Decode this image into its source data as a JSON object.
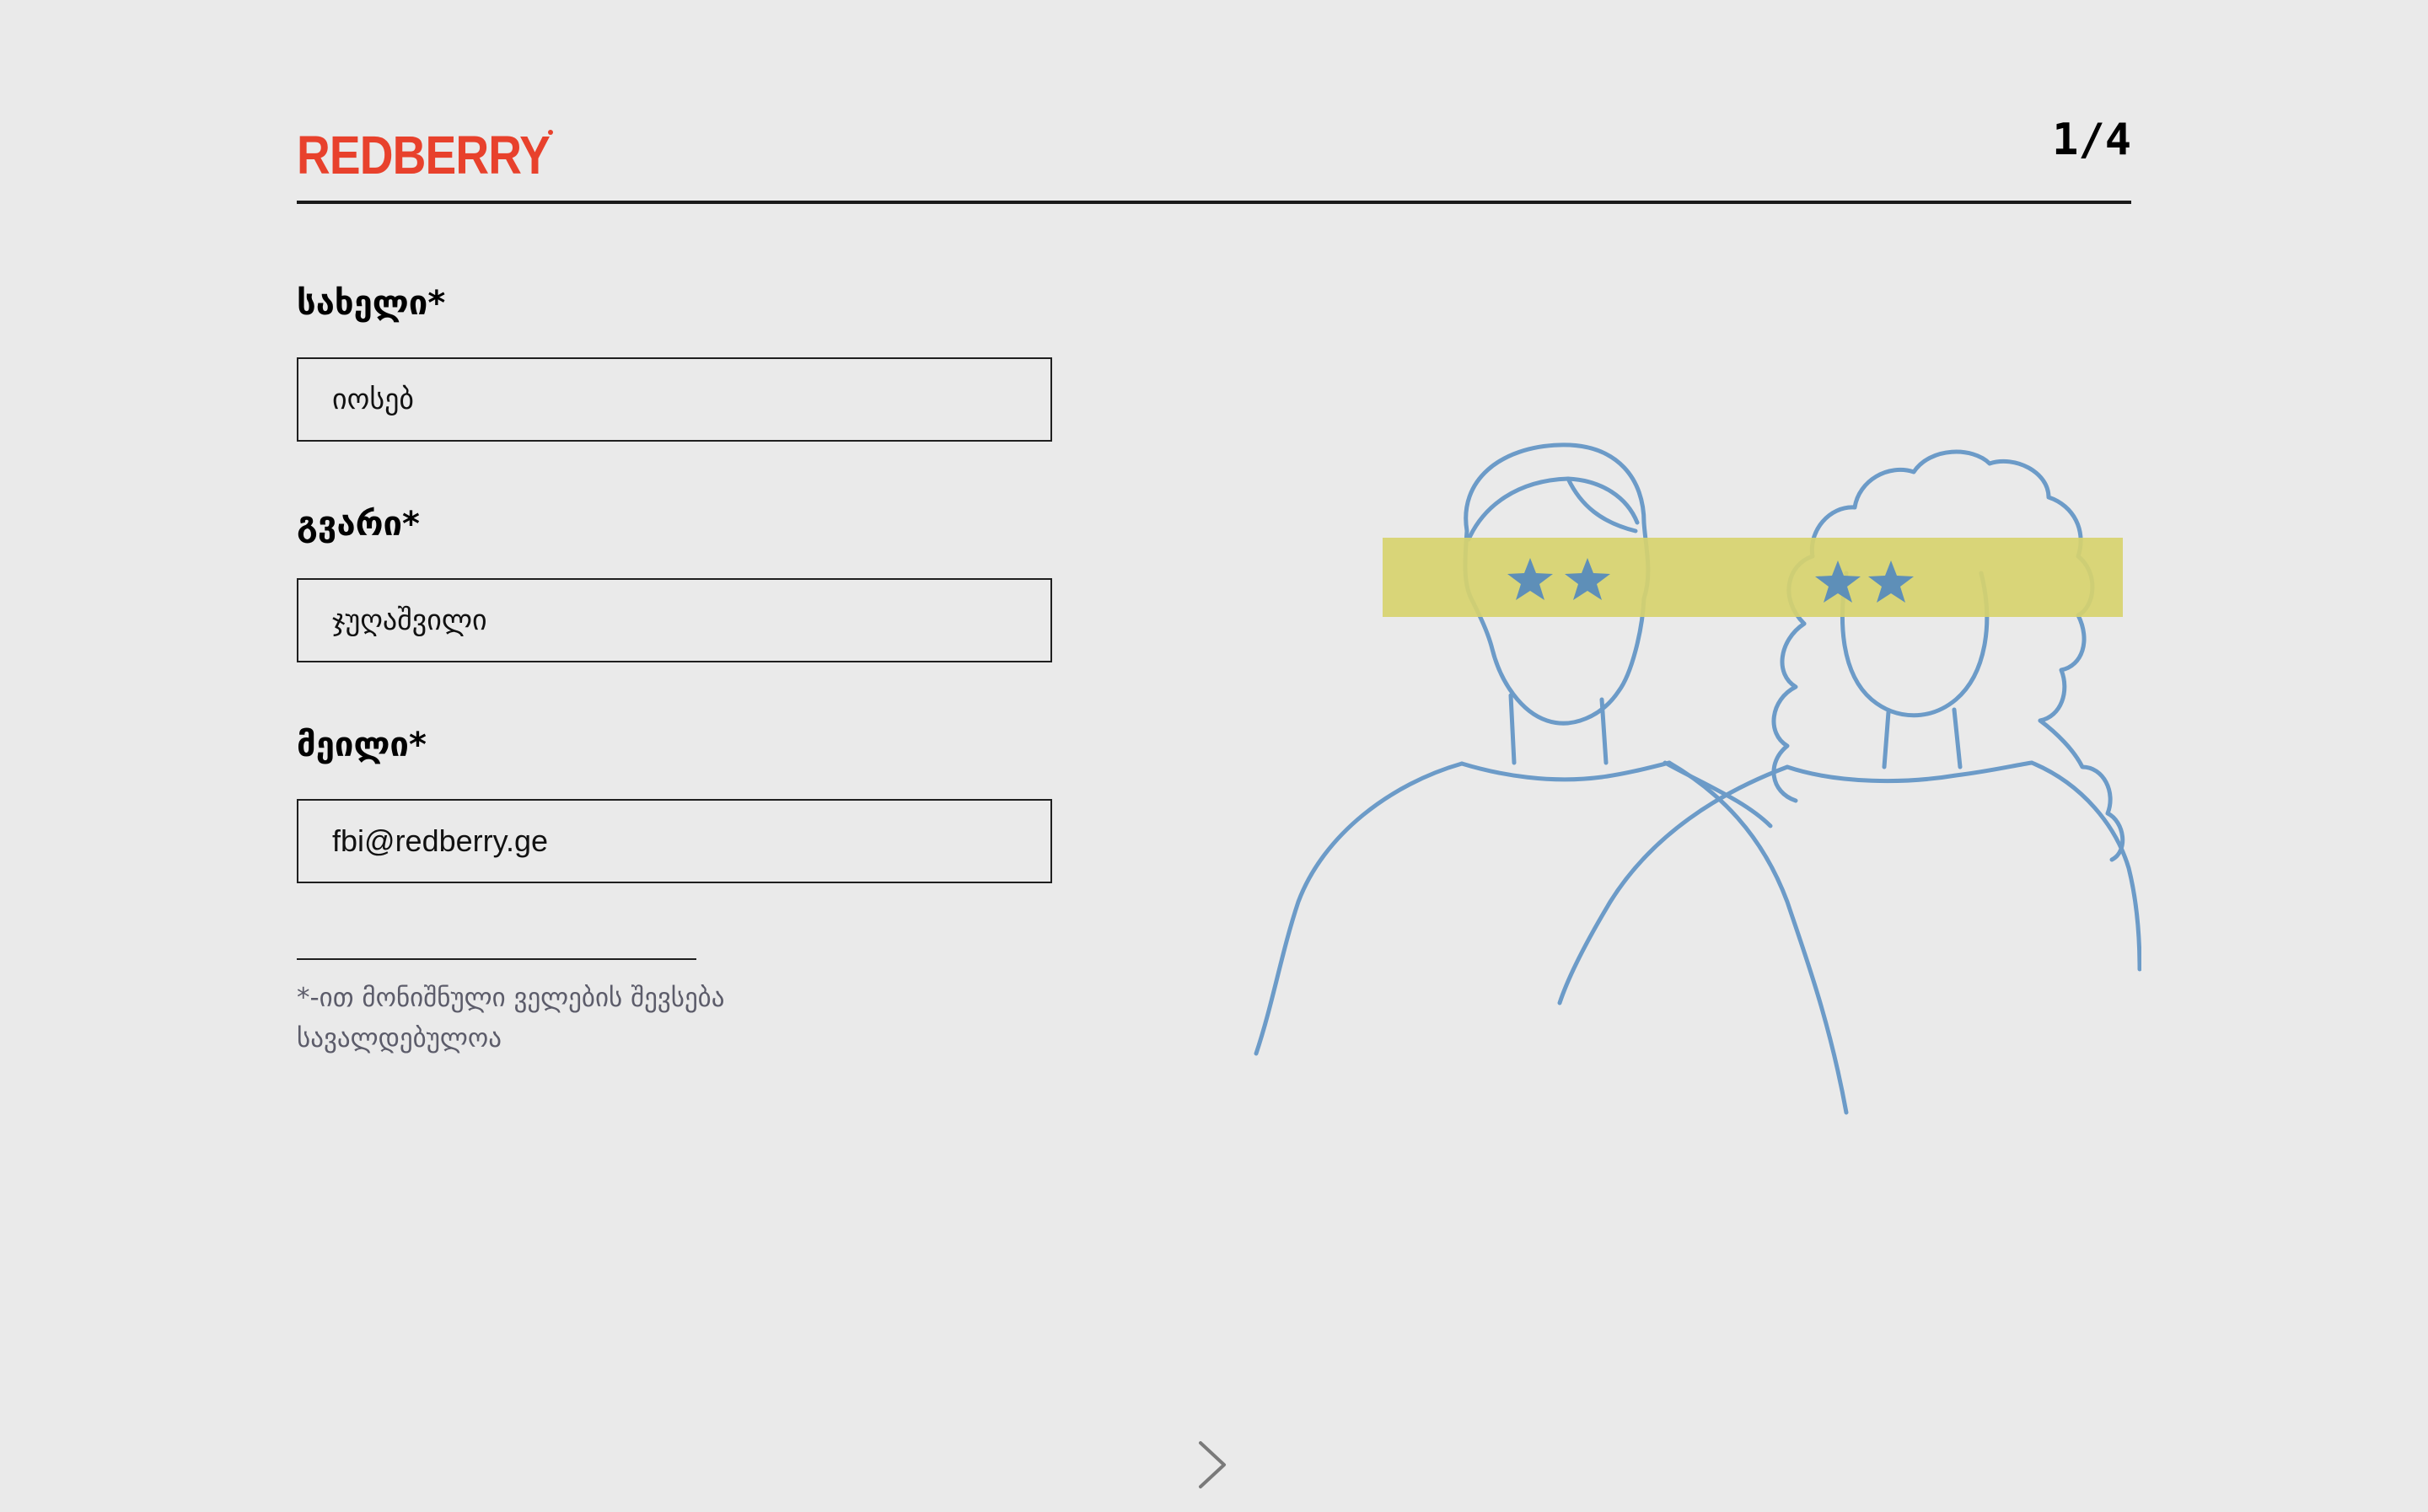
{
  "header": {
    "logo_text": "REDBERRY",
    "step_counter": "1/4"
  },
  "form": {
    "fields": [
      {
        "label": "სახელი*",
        "value": "იოსებ"
      },
      {
        "label": "გვარი*",
        "value": "ჯუღაშვილი"
      },
      {
        "label": "მეილი*",
        "value": "fbi@redberry.ge"
      }
    ],
    "required_note": "*-ით მონიშნული ველების შევსება სავალდებულოა"
  },
  "illustration": {
    "icon": "two-people-with-star-eyes-illustration",
    "colors": {
      "line": "#6C9BC8",
      "band": "#D7D26E",
      "star": "#5E8FB8"
    }
  },
  "navigation": {
    "next_icon": "chevron-right-icon"
  },
  "colors": {
    "background": "#EAEAEA",
    "brand": "#E8412C",
    "text": "#000000",
    "muted": "#5C5C6A"
  }
}
